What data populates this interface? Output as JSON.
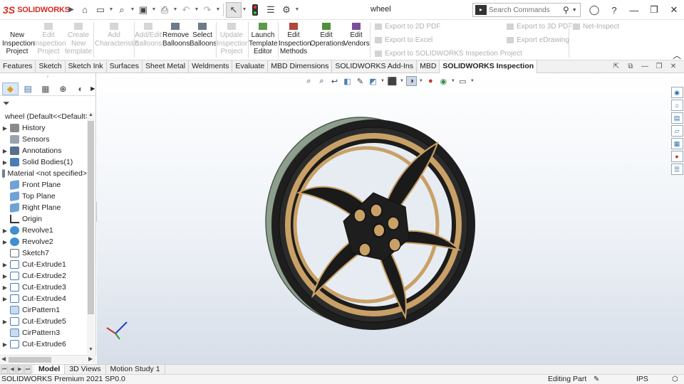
{
  "app": {
    "logo_mark": "3S",
    "logo_word": "SOLIDWORKS",
    "document_title": "wheel",
    "search": {
      "placeholder": "Search Commands"
    }
  },
  "command_manager": {
    "buttons": [
      {
        "line1": "New",
        "line2": "Inspection",
        "line3": "Project",
        "enabled": true
      },
      {
        "line1": "Edit",
        "line2": "Inspection",
        "line3": "Project",
        "enabled": false
      },
      {
        "line1": "Create",
        "line2": "New",
        "line3": "template",
        "enabled": false
      },
      {
        "line1": "Add",
        "line2": "Characteristic",
        "line3": "",
        "enabled": false
      },
      {
        "line1": "Add/Edit",
        "line2": "Balloons",
        "line3": "",
        "enabled": false
      },
      {
        "line1": "Remove",
        "line2": "Balloons",
        "line3": "",
        "enabled": true
      },
      {
        "line1": "Select",
        "line2": "Balloons",
        "line3": "",
        "enabled": true
      },
      {
        "line1": "Update",
        "line2": "Inspection",
        "line3": "Project",
        "enabled": false
      },
      {
        "line1": "Launch",
        "line2": "Template",
        "line3": "Editor",
        "enabled": true
      },
      {
        "line1": "Edit",
        "line2": "Inspection",
        "line3": "Methods",
        "enabled": true
      },
      {
        "line1": "Edit",
        "line2": "Operations",
        "line3": "",
        "enabled": true
      },
      {
        "line1": "Edit",
        "line2": "Vendors",
        "line3": "",
        "enabled": true
      }
    ],
    "exports": {
      "pdf2d": "Export to 2D PDF",
      "excel": "Export to Excel",
      "inspection_project": "Export to SOLIDWORKS Inspection Project",
      "pdf3d": "Export to 3D PDF",
      "edrawing": "Export eDrawing",
      "net_inspect": "Net-Inspect"
    }
  },
  "tabs": [
    {
      "label": "Features",
      "active": false
    },
    {
      "label": "Sketch",
      "active": false
    },
    {
      "label": "Sketch Ink",
      "active": false
    },
    {
      "label": "Surfaces",
      "active": false
    },
    {
      "label": "Sheet Metal",
      "active": false
    },
    {
      "label": "Weldments",
      "active": false
    },
    {
      "label": "Evaluate",
      "active": false
    },
    {
      "label": "MBD Dimensions",
      "active": false
    },
    {
      "label": "SOLIDWORKS Add-Ins",
      "active": false
    },
    {
      "label": "MBD",
      "active": false
    },
    {
      "label": "SOLIDWORKS Inspection",
      "active": true
    }
  ],
  "feature_tree": {
    "root": "wheel  (Default<<Default>",
    "nodes": [
      {
        "label": "History",
        "icon": "history",
        "expandable": true
      },
      {
        "label": "Sensors",
        "icon": "sensors",
        "expandable": false
      },
      {
        "label": "Annotations",
        "icon": "annot",
        "expandable": true
      },
      {
        "label": "Solid Bodies(1)",
        "icon": "solid",
        "expandable": true
      },
      {
        "label": "Material <not specified>",
        "icon": "material",
        "expandable": false
      },
      {
        "label": "Front Plane",
        "icon": "plane",
        "expandable": false
      },
      {
        "label": "Top Plane",
        "icon": "plane",
        "expandable": false
      },
      {
        "label": "Right Plane",
        "icon": "plane",
        "expandable": false
      },
      {
        "label": "Origin",
        "icon": "origin",
        "expandable": false
      },
      {
        "label": "Revolve1",
        "icon": "revolve",
        "expandable": true
      },
      {
        "label": "Revolve2",
        "icon": "revolve",
        "expandable": true
      },
      {
        "label": "Sketch7",
        "icon": "sketch",
        "expandable": false
      },
      {
        "label": "Cut-Extrude1",
        "icon": "cut",
        "expandable": true
      },
      {
        "label": "Cut-Extrude2",
        "icon": "cut",
        "expandable": true
      },
      {
        "label": "Cut-Extrude3",
        "icon": "cut",
        "expandable": true
      },
      {
        "label": "Cut-Extrude4",
        "icon": "cut",
        "expandable": true
      },
      {
        "label": "CirPattern1",
        "icon": "pattern",
        "expandable": false
      },
      {
        "label": "Cut-Extrude5",
        "icon": "cut",
        "expandable": true
      },
      {
        "label": "CirPattern3",
        "icon": "pattern",
        "expandable": false
      },
      {
        "label": "Cut-Extrude6",
        "icon": "cut",
        "expandable": true
      }
    ]
  },
  "bottom_tabs": [
    {
      "label": "Model",
      "active": true
    },
    {
      "label": "3D Views",
      "active": false
    },
    {
      "label": "Motion Study 1",
      "active": false
    }
  ],
  "status_bar": {
    "product": "SOLIDWORKS Premium 2021 SP0.0",
    "mode": "Editing Part",
    "units": "IPS"
  },
  "colors": {
    "brand_red": "#d52b1e",
    "wheel_black": "#1e1e1e",
    "wheel_gold": "#c9a066",
    "tire_green": "#8e9e8c"
  }
}
